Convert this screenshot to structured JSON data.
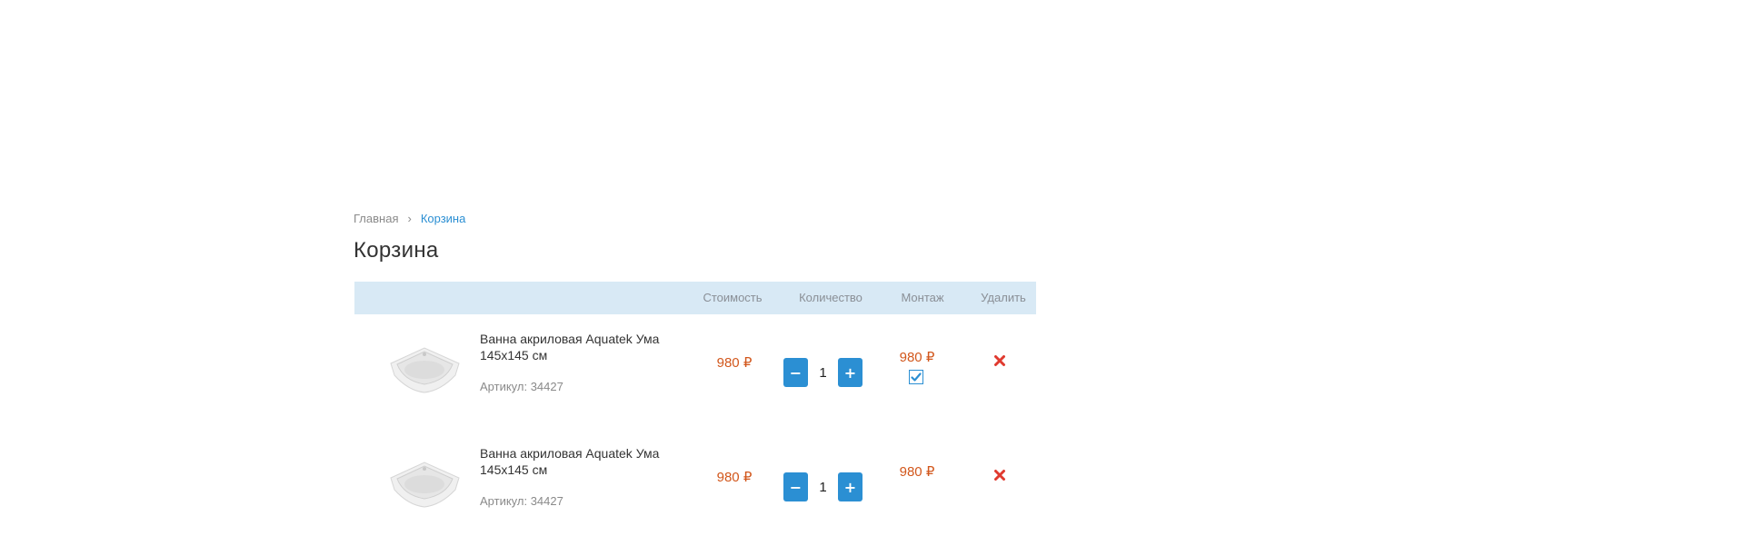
{
  "breadcrumb": {
    "home": "Главная",
    "separator": "›",
    "current": "Корзина"
  },
  "page_title": "Корзина",
  "table": {
    "headers": {
      "price": "Стоимость",
      "quantity": "Количество",
      "mount": "Монтаж",
      "delete": "Удалить"
    },
    "rows": [
      {
        "name": "Ванна акриловая Aquatek Ума 145х145 см",
        "sku": "Артикул: 34427",
        "price": "980 ₽",
        "qty_minus": "−",
        "qty_plus": "+",
        "quantity": "1",
        "mount_price": "980 ₽",
        "mount_checked": true
      },
      {
        "name": "Ванна акриловая Aquatek Ума 145х145 см",
        "sku": "Артикул: 34427",
        "price": "980 ₽",
        "qty_minus": "−",
        "qty_plus": "+",
        "quantity": "1",
        "mount_price": "980 ₽",
        "mount_checked": false
      }
    ]
  },
  "colors": {
    "accent": "#2b8fd3",
    "price": "#d2571c",
    "header_bg": "#d8e9f5",
    "delete": "#e03a2f"
  },
  "icons": {
    "thumbnail": "corner-bathtub-image",
    "checkbox": "check-icon",
    "delete": "close-icon"
  }
}
